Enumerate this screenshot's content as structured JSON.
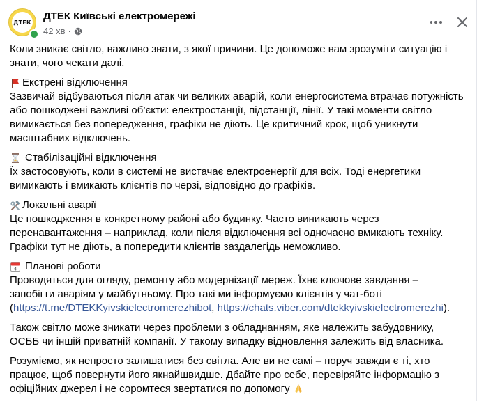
{
  "header": {
    "page_name": "ДТЕК Київські електромережі",
    "time_ago": "42 хв",
    "separator": "·",
    "avatar_text": "ДТЕК"
  },
  "icons": {
    "avatar": "dtek-logo-icon",
    "audience": "globe-icon",
    "more": "more-options-icon",
    "close": "close-icon",
    "emergency": "red-flag-icon",
    "stabilization": "hourglass-icon",
    "local": "hammer-and-wrench-icon",
    "planned": "calendar-icon",
    "closing": "folded-hands-icon"
  },
  "colors": {
    "accent_link": "#385898",
    "brand_yellow": "#f7d74a",
    "online": "#31a24c"
  },
  "post": {
    "intro": "Коли зникає світло, важливо знати, з якої причини. Це допоможе вам зрозуміти ситуацію і знати, чого чекати далі.",
    "emergency_title": "Екстрені відключення",
    "emergency_text": "Зазвичай відбуваються після атак чи великих аварій, коли енергосистема втрачає потужність або пошкоджені важливі об’єкти: електростанції, підстанції, лінії. У такі моменти світло вимикається без попередження, графіки не діють. Це критичний крок, щоб уникнути масштабних відключень.",
    "stabilization_title": "Стабілізаційні відключення",
    "stabilization_text": "Їх застосовують, коли в системі не вистачає електроенергії для всіх. Тоді енергетики вимикають і вмикають клієнтів по черзі, відповідно до графіків.",
    "local_title": "Локальні аварії",
    "local_text": "Це пошкодження в конкретному районі або будинку. Часто виникають через перенавантаження – наприклад, коли після відключення всі одночасно вмикають техніку. Графіки тут не діють, а попередити клієнтів заздалегідь неможливо.",
    "planned_title": "Планові роботи",
    "planned_text": "Проводяться для огляду, ремонту або модернізації мереж. Їхнє ключове завдання – запобігти аваріям у майбутньому. Про такі ми інформуємо клієнтів у чат-боті",
    "planned_open": "(",
    "link_telegram": "https://t.me/DTEKKyivskielectromerezhibot",
    "link_sep": ", ",
    "link_viber": "https://chats.viber.com/dtekkyivskielectromerezhi",
    "planned_close": ").",
    "other_text": "Також світло може зникати через проблеми з обладнанням, яке належить забудовнику, ОСББ чи іншій приватній компанії. У такому випадку відновлення залежить від власника.",
    "closing_text": "Розуміємо, як непросто залишатися без світла. Але ви не самі – поруч завжди є ті, хто працює, щоб повернути його якнайшвидше. Дбайте про себе, перевіряйте інформацію з офіційних джерел і не соромтеся звертатися по допомогу"
  }
}
